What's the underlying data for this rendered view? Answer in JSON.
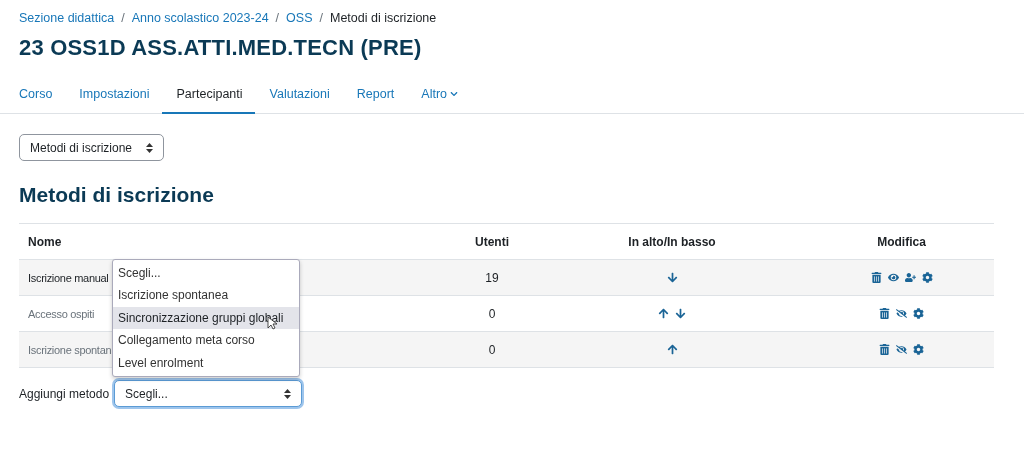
{
  "breadcrumb": [
    {
      "label": "Sezione didattica",
      "link": true
    },
    {
      "label": "Anno scolastico 2023-24",
      "link": true
    },
    {
      "label": "OSS",
      "link": true
    },
    {
      "label": "Metodi di iscrizione",
      "link": false
    }
  ],
  "breadcrumb_separator": "/",
  "course_title": "23 OSS1D ASS.ATTI.MED.TECN (PRE)",
  "tabs": [
    {
      "label": "Corso",
      "selected": false,
      "dropdown": false
    },
    {
      "label": "Impostazioni",
      "selected": false,
      "dropdown": false
    },
    {
      "label": "Partecipanti",
      "selected": true,
      "dropdown": false
    },
    {
      "label": "Valutazioni",
      "selected": false,
      "dropdown": false
    },
    {
      "label": "Report",
      "selected": false,
      "dropdown": false
    },
    {
      "label": "Altro",
      "selected": false,
      "dropdown": true
    }
  ],
  "page_select": {
    "value": "Metodi di iscrizione"
  },
  "heading": "Metodi di iscrizione",
  "table": {
    "columns": [
      "Nome",
      "Utenti",
      "In alto/In basso",
      "Modifica"
    ],
    "rows": [
      {
        "name": "Iscrizione manual",
        "users": "19",
        "disabled": false,
        "move": [
          {
            "kind": "down"
          }
        ],
        "actions": [
          {
            "kind": "delete"
          },
          {
            "kind": "show"
          },
          {
            "kind": "enrol"
          },
          {
            "kind": "settings"
          }
        ]
      },
      {
        "name": "Accesso ospiti",
        "users": "0",
        "disabled": true,
        "move": [
          {
            "kind": "up"
          },
          {
            "kind": "down"
          }
        ],
        "actions": [
          {
            "kind": "delete"
          },
          {
            "kind": "hidden"
          },
          {
            "kind": "settings"
          }
        ]
      },
      {
        "name": "Iscrizione spontan",
        "users": "0",
        "disabled": true,
        "move": [
          {
            "kind": "up"
          }
        ],
        "actions": [
          {
            "kind": "delete"
          },
          {
            "kind": "hidden"
          },
          {
            "kind": "settings"
          }
        ]
      }
    ]
  },
  "add_method": {
    "label": "Aggiungi metodo",
    "value": "Scegli...",
    "expanded": true,
    "options": [
      {
        "label": "Scegli...",
        "highlighted": false
      },
      {
        "label": "Iscrizione spontanea",
        "highlighted": false
      },
      {
        "label": "Sincronizzazione gruppi globali",
        "highlighted": true
      },
      {
        "label": "Collegamento meta corso",
        "highlighted": false
      },
      {
        "label": "Level enrolment",
        "highlighted": false
      }
    ]
  }
}
